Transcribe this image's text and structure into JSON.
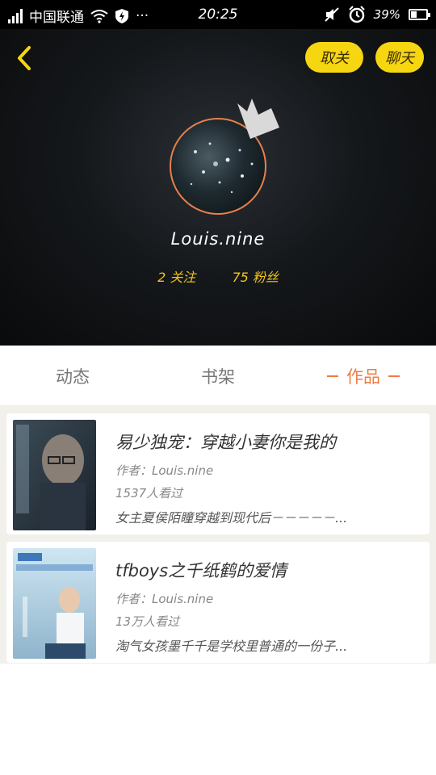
{
  "status_bar": {
    "carrier": "中国联通",
    "time": "20:25",
    "battery": "39%",
    "battery_level": 0.39,
    "more": "···"
  },
  "header": {
    "follow_button": "取关",
    "chat_button": "聊天"
  },
  "profile": {
    "username": "Louis.nine",
    "following": "2 关注",
    "fans": "75 粉丝"
  },
  "tabs": [
    {
      "label": "动态",
      "active": false
    },
    {
      "label": "书架",
      "active": false
    },
    {
      "label": "作品",
      "active": true
    }
  ],
  "works": [
    {
      "title": "易少独宠：穿越小妻你是我的",
      "author": "作者：Louis.nine",
      "readers": "1537人看过",
      "description": "女主夏侯陌瞳穿越到现代后－－－－－..."
    },
    {
      "title": "tfboys之千纸鹤的爱情",
      "author": "作者：Louis.nine",
      "readers": "13万人看过",
      "description": "淘气女孩墨千千是学校里普通的一份子..."
    }
  ],
  "colors": {
    "accent": "#ef7b43",
    "button_yellow": "#f6d611",
    "stats_yellow": "#f3c41a"
  }
}
